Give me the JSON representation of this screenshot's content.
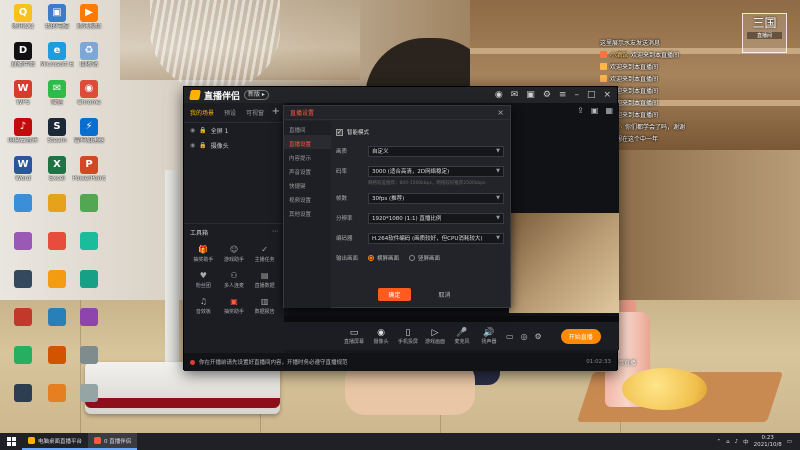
{
  "desktop": {
    "icons": [
      {
        "label": "腾讯QQ",
        "color": "#f7c21b",
        "glyph": "Q"
      },
      {
        "label": "我的电脑",
        "color": "#3d7cc9",
        "glyph": "▣"
      },
      {
        "label": "腾讯视频",
        "color": "#ff7a00",
        "glyph": "▶"
      },
      {
        "label": "直播伴侣",
        "color": "#111111",
        "glyph": "D"
      },
      {
        "label": "Microsoft Edge",
        "color": "#1f9be0",
        "glyph": "e"
      },
      {
        "label": "回收站",
        "color": "#7ea7d8",
        "glyph": "♻"
      },
      {
        "label": "WPS",
        "color": "#d63b2b",
        "glyph": "W"
      },
      {
        "label": "微信",
        "color": "#2dbb4a",
        "glyph": "✉"
      },
      {
        "label": "Chrome",
        "color": "#dd4b39",
        "glyph": "◉"
      },
      {
        "label": "网易云音乐",
        "color": "#c20c0c",
        "glyph": "♪"
      },
      {
        "label": "Steam",
        "color": "#1b2838",
        "glyph": "S"
      },
      {
        "label": "雷神加速器",
        "color": "#0a6ed1",
        "glyph": "⚡"
      },
      {
        "label": "Word",
        "color": "#2b579a",
        "glyph": "W"
      },
      {
        "label": "Excel",
        "color": "#217346",
        "glyph": "X"
      },
      {
        "label": "PowerPoint",
        "color": "#d24726",
        "glyph": "P"
      }
    ]
  },
  "app": {
    "name": "直播伴侣",
    "version_badge": "新版 ▸",
    "scene_tabs": [
      "我的场景",
      "预设",
      "可视窗"
    ],
    "scenes": [
      {
        "label": "全屏 1"
      },
      {
        "label": "摄像头"
      }
    ],
    "tools_title": "工具箱",
    "tools": [
      {
        "label": "抽奖助手",
        "icon": "🎁",
        "color": "#ff5a3c"
      },
      {
        "label": "游戏助手",
        "icon": "☺",
        "color": "#aaaaaa"
      },
      {
        "label": "主播任务",
        "icon": "✓",
        "color": "#aaaaaa"
      },
      {
        "label": "粉丝团",
        "icon": "♥",
        "color": "#aaaaaa"
      },
      {
        "label": "多人连麦",
        "icon": "⚇",
        "color": "#aaaaaa"
      },
      {
        "label": "直播数据",
        "icon": "▤",
        "color": "#aaaaaa"
      },
      {
        "label": "音效板",
        "icon": "♫",
        "color": "#aaaaaa"
      },
      {
        "label": "抽奖助手",
        "icon": "▣",
        "color": "#ff5a3c"
      },
      {
        "label": "数据报告",
        "icon": "▥",
        "color": "#aaaaaa"
      }
    ],
    "bottom_tools": [
      {
        "label": "直播屏幕",
        "icon": "▭"
      },
      {
        "label": "摄像头",
        "icon": "◉"
      },
      {
        "label": "手机投屏",
        "icon": "▯"
      },
      {
        "label": "游戏画面",
        "icon": "▷"
      },
      {
        "label": "麦克风",
        "icon": "🎤"
      },
      {
        "label": "扬声器",
        "icon": "🔊"
      }
    ],
    "start_live_label": "开始直播",
    "notice_text": "你在开播前请先设置好直播间内容，开播时务必遵守直播规范",
    "notice_time": "01:02:33"
  },
  "settings": {
    "title": "直播设置",
    "close": "×",
    "nav": [
      {
        "label": "直播间"
      },
      {
        "label": "直播设置"
      },
      {
        "label": "内容提示"
      },
      {
        "label": "声音设置"
      },
      {
        "label": "快捷键"
      },
      {
        "label": "视频设置"
      },
      {
        "label": "其他设置"
      }
    ],
    "smart_mode_label": "智能模式",
    "rows": [
      {
        "label": "画质",
        "value": "自定义"
      },
      {
        "label": "码率",
        "value": "3000 (适合高清，2D网络稳定)"
      },
      {
        "label": "帧数",
        "value": "30fps (推荐)"
      },
      {
        "label": "分辨率",
        "value": "1920*1080 (1:1) 直播比例"
      },
      {
        "label": "编码器",
        "value": "H.264软件编码 (画质较好，但CPU消耗较大)"
      }
    ],
    "bitrate_hint": "网络较差推荐：800-1500kbps，网络较好推荐2500kbps",
    "output_label": "输出画面",
    "output_options": [
      "横屏画面",
      "竖屏画面"
    ],
    "confirm_label": "确定",
    "cancel_label": "取消"
  },
  "chat": {
    "header": "这里展示水友发送消息",
    "lines": [
      {
        "name": "小酒馆",
        "text": "欢迎来到本直播间",
        "color": "#ff7043"
      },
      {
        "name": "",
        "text": "欢迎来到本直播间",
        "color": "#ffb74d"
      },
      {
        "name": "",
        "text": "欢迎来到本直播间",
        "color": "#ffb74d"
      },
      {
        "name": "",
        "text": "欢迎来到本直播间",
        "color": "#4fc3f7"
      },
      {
        "name": "",
        "text": "欢迎来到本直播间",
        "color": "#81c784"
      },
      {
        "name": "",
        "text": "欢迎来到本直播间",
        "color": "#ba68c8"
      },
      {
        "name": "小小",
        "text": "你们都学会了吗，谢谢",
        "color": "#ffb74d"
      },
      {
        "name": "",
        "text": "我想在这个中一年",
        "color": "#ff8a65"
      }
    ],
    "corner_title": "三国",
    "corner_sub": "直播间",
    "live_notice": "这里展示直播"
  },
  "taskbar": {
    "items": [
      {
        "label": "电脑桌面直播平台",
        "color": "#ffb300",
        "active": false
      },
      {
        "label": "0 直播伴侣",
        "color": "#ff5a3c",
        "active": true
      }
    ],
    "time": "0:23",
    "date": "2021/10/8"
  }
}
